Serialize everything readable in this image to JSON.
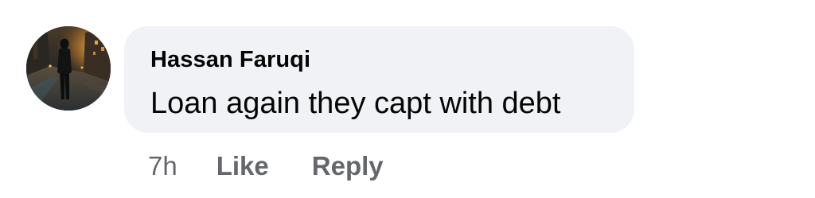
{
  "comment": {
    "author_name": "Hassan Faruqi",
    "text": "Loan again they capt with debt",
    "timestamp": "7h",
    "actions": {
      "like_label": "Like",
      "reply_label": "Reply"
    },
    "avatar_icon": "profile-photo-night-street",
    "colors": {
      "bubble_background": "#f0f2f5",
      "primary_text": "#050505",
      "secondary_text": "#65676b"
    }
  }
}
